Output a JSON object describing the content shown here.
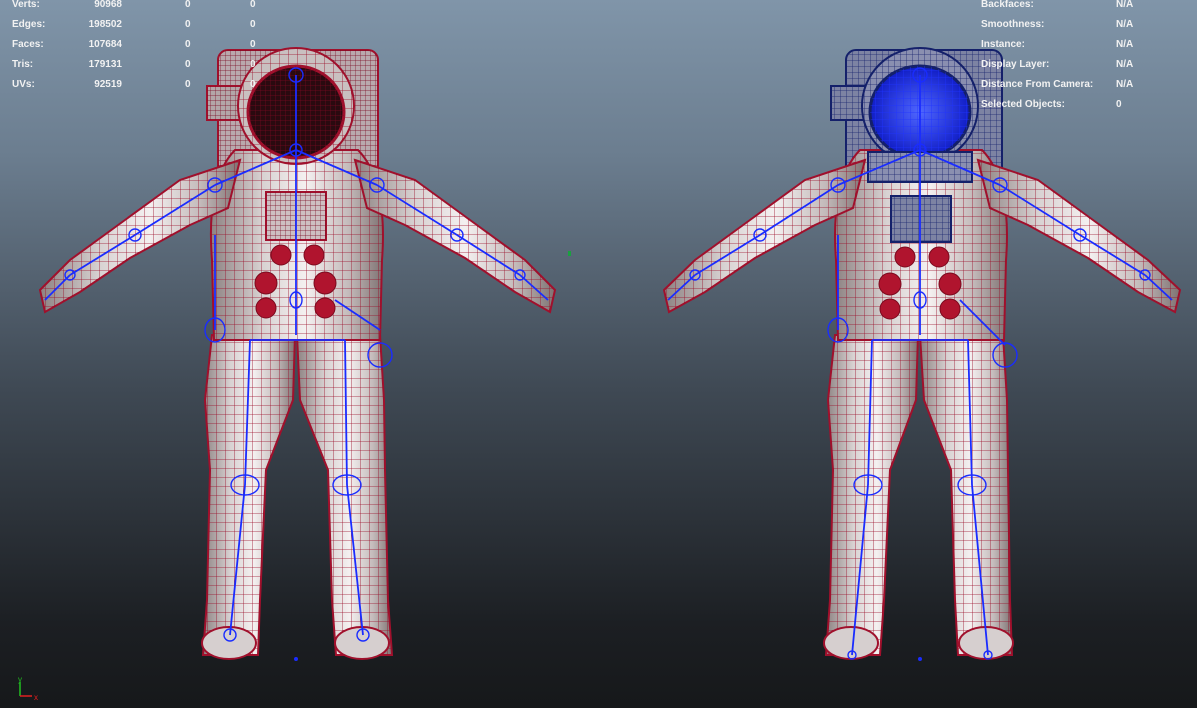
{
  "hud_left": {
    "rows": [
      {
        "label": "Verts:",
        "value": "90968",
        "a": "0",
        "b": "0"
      },
      {
        "label": "Edges:",
        "value": "198502",
        "a": "0",
        "b": "0"
      },
      {
        "label": "Faces:",
        "value": "107684",
        "a": "0",
        "b": "0"
      },
      {
        "label": "Tris:",
        "value": "179131",
        "a": "0",
        "b": "0"
      },
      {
        "label": "UVs:",
        "value": "92519",
        "a": "0",
        "b": "0"
      }
    ]
  },
  "hud_right": {
    "rows": [
      {
        "label": "Backfaces:",
        "value": "N/A"
      },
      {
        "label": "Smoothness:",
        "value": "N/A"
      },
      {
        "label": "Instance:",
        "value": "N/A"
      },
      {
        "label": "Display Layer:",
        "value": "N/A"
      },
      {
        "label": "Distance From Camera:",
        "value": "N/A"
      },
      {
        "label": "Selected Objects:",
        "value": "0"
      }
    ]
  },
  "axis": {
    "y_label": "y",
    "x_label": "x"
  },
  "colors": {
    "wire_red": "#a0102c",
    "wire_blue": "#1a2cff",
    "wire_navy": "#14206a",
    "suit": "#c9c2c2",
    "axis_x": "#e02020",
    "axis_y": "#20c020"
  },
  "icons": [
    "view-axis-icon"
  ]
}
